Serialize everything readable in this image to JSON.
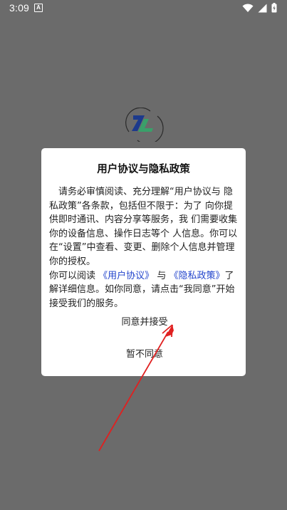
{
  "status_bar": {
    "time": "3:09",
    "notification_icon_letter": "A",
    "icons": [
      "wifi-icon",
      "cell-signal-icon",
      "battery-charging-icon"
    ]
  },
  "colors": {
    "overlay": "#6b6b6b",
    "link": "#2244cc",
    "arrow": "#e02020",
    "logo_blue": "#1c3a8c",
    "logo_green": "#3aa06a"
  },
  "dialog": {
    "title": "用户协议与隐私政策",
    "para1": "请务必审慎阅读、充分理解“用户协议与 隐私政策”各条款，包括但不限于：为了 向你提供即时通讯、内容分享等服务，我 们需要收集你的设备信息、操作日志等个 人信息。你可以在“设置”中查看、变更、删除个人信息并管理你的授权。",
    "para2_prefix": "你可以阅读",
    "user_agreement_link": "《用户协议》",
    "para2_and": "与",
    "privacy_policy_link": "《隐私政策》",
    "para2_suffix": "了解详细信息。如你同意，请点击“我同意”开始接受我们的服务。",
    "accept_label": "同意并接受",
    "decline_label": "暂不同意"
  }
}
